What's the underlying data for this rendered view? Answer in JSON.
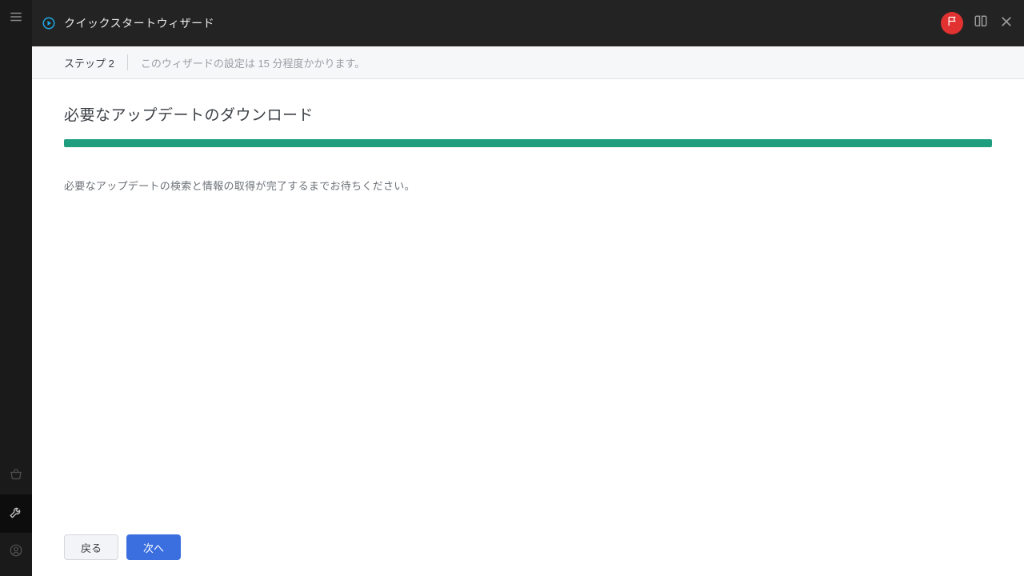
{
  "header": {
    "title": "クイックスタートウィザード"
  },
  "subheader": {
    "step_label": "ステップ 2",
    "description": "このウィザードの設定は 15 分程度かかります。"
  },
  "main": {
    "heading": "必要なアップデートのダウンロード",
    "progress_percent": 100,
    "body_text": "必要なアップデートの検索と情報の取得が完了するまでお待ちください。"
  },
  "footer": {
    "back_label": "戻る",
    "next_label": "次へ"
  },
  "colors": {
    "progress": "#1f9d7f",
    "primary": "#3b6fe0",
    "flag": "#e13131"
  }
}
